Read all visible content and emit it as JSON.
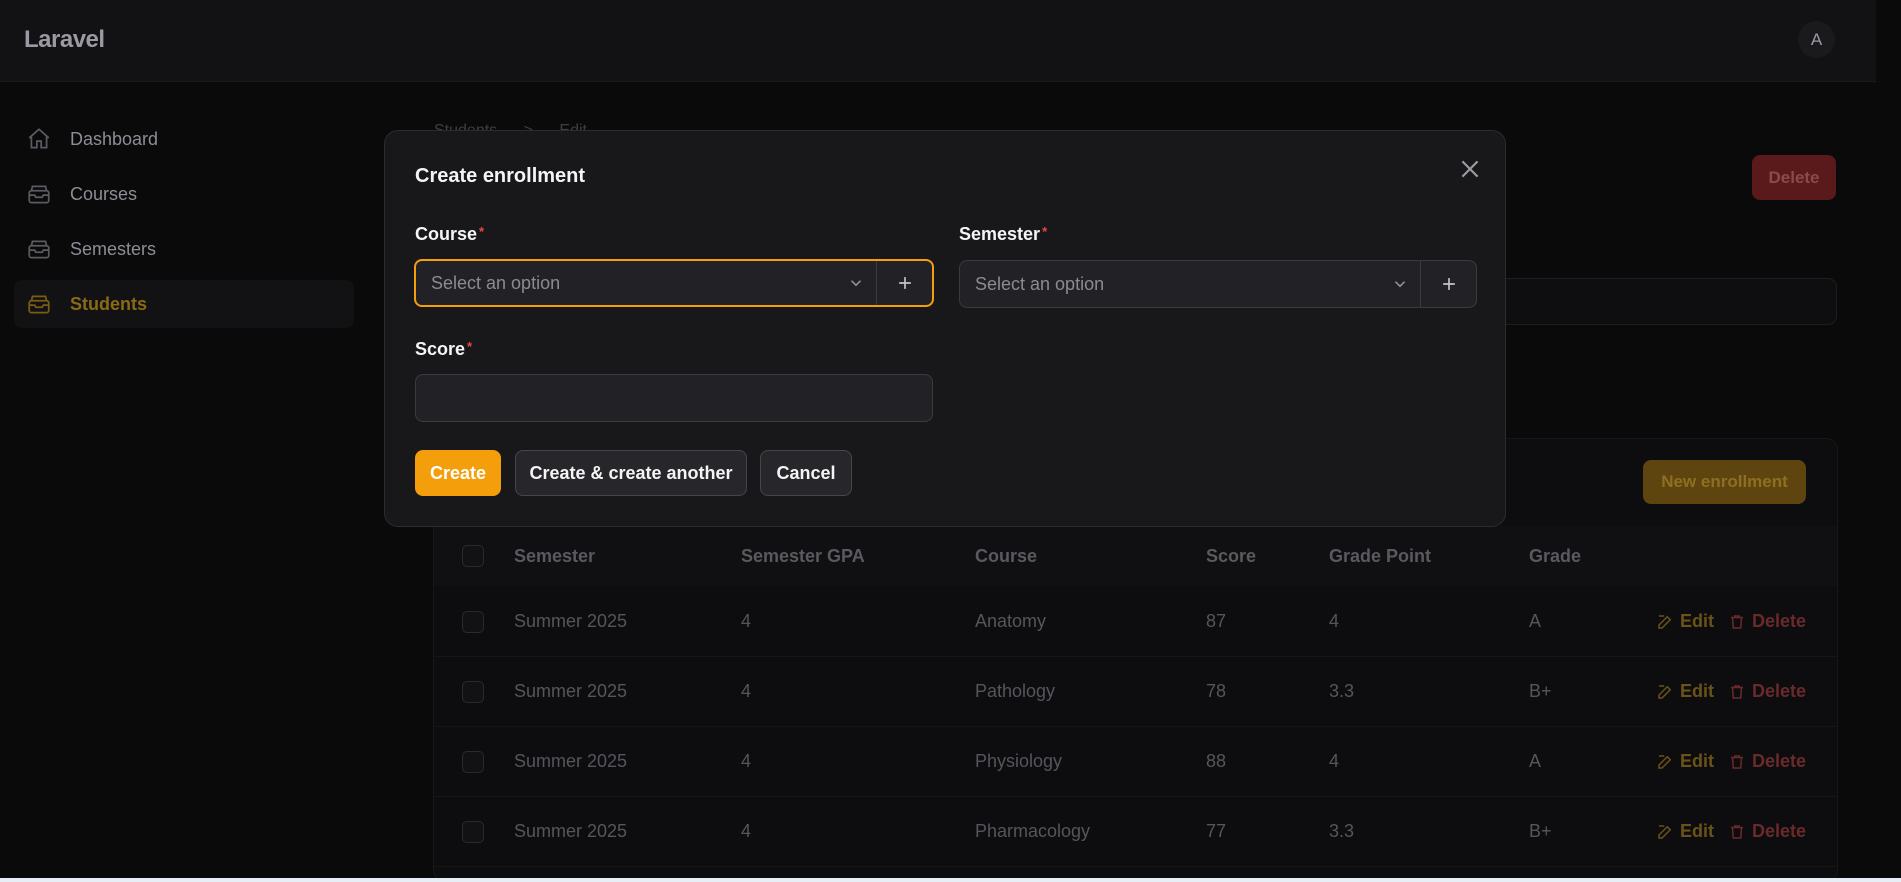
{
  "app": {
    "brand": "Laravel",
    "avatar_initial": "A"
  },
  "sidebar": {
    "items": [
      {
        "label": "Dashboard",
        "icon": "home-icon",
        "active": false
      },
      {
        "label": "Courses",
        "icon": "inbox-stack-icon",
        "active": false
      },
      {
        "label": "Semesters",
        "icon": "inbox-stack-icon",
        "active": false
      },
      {
        "label": "Students",
        "icon": "inbox-stack-icon",
        "active": true
      }
    ]
  },
  "breadcrumb": {
    "items": [
      "Students",
      ">",
      "Edit"
    ]
  },
  "header": {
    "delete_label": "Delete"
  },
  "relation": {
    "new_label": "New enrollment",
    "columns": [
      "Semester",
      "Semester GPA",
      "Course",
      "Score",
      "Grade Point",
      "Grade"
    ],
    "rows": [
      {
        "semester": "Summer 2025",
        "gpa": "4",
        "course": "Anatomy",
        "score": "87",
        "grade_point": "4",
        "grade": "A"
      },
      {
        "semester": "Summer 2025",
        "gpa": "4",
        "course": "Pathology",
        "score": "78",
        "grade_point": "3.3",
        "grade": "B+"
      },
      {
        "semester": "Summer 2025",
        "gpa": "4",
        "course": "Physiology",
        "score": "88",
        "grade_point": "4",
        "grade": "A"
      },
      {
        "semester": "Summer 2025",
        "gpa": "4",
        "course": "Pharmacology",
        "score": "77",
        "grade_point": "3.3",
        "grade": "B+"
      }
    ],
    "edit_label": "Edit",
    "delete_label": "Delete"
  },
  "modal": {
    "title": "Create enrollment",
    "course": {
      "label": "Course",
      "required": "*",
      "placeholder": "Select an option"
    },
    "semester": {
      "label": "Semester",
      "required": "*",
      "placeholder": "Select an option"
    },
    "score": {
      "label": "Score",
      "required": "*",
      "value": ""
    },
    "create_label": "Create",
    "create_another_label": "Create & create another",
    "cancel_label": "Cancel"
  },
  "colors": {
    "accent": "#f59e0b",
    "danger": "#ef4444",
    "surface": "#18181b"
  }
}
